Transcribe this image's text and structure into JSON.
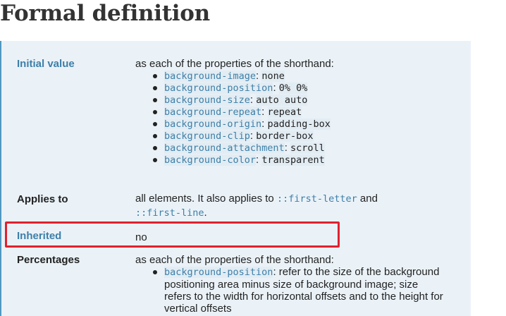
{
  "title": "Formal definition",
  "rows": {
    "initial": {
      "label": "Initial value",
      "intro": "as each of the properties of the shorthand:",
      "items": [
        {
          "prop": "background-image",
          "value": "none"
        },
        {
          "prop": "background-position",
          "value": "0% 0%"
        },
        {
          "prop": "background-size",
          "value": "auto auto"
        },
        {
          "prop": "background-repeat",
          "value": "repeat"
        },
        {
          "prop": "background-origin",
          "value": "padding-box"
        },
        {
          "prop": "background-clip",
          "value": "border-box"
        },
        {
          "prop": "background-attachment",
          "value": "scroll"
        },
        {
          "prop": "background-color",
          "value": "transparent"
        }
      ]
    },
    "applies": {
      "label": "Applies to",
      "text1": "all elements. It also applies to ",
      "code1": "::first-letter",
      "text2": " and",
      "code2": "::first-line",
      "text3": "."
    },
    "inherited": {
      "label": "Inherited",
      "value": "no"
    },
    "percentages": {
      "label": "Percentages",
      "intro": "as each of the properties of the shorthand:",
      "item_prop": "background-position",
      "item_text": "refer to the size of the background positioning area minus size of background image; size refers to the width for horizontal offsets and to the height for vertical offsets"
    }
  }
}
